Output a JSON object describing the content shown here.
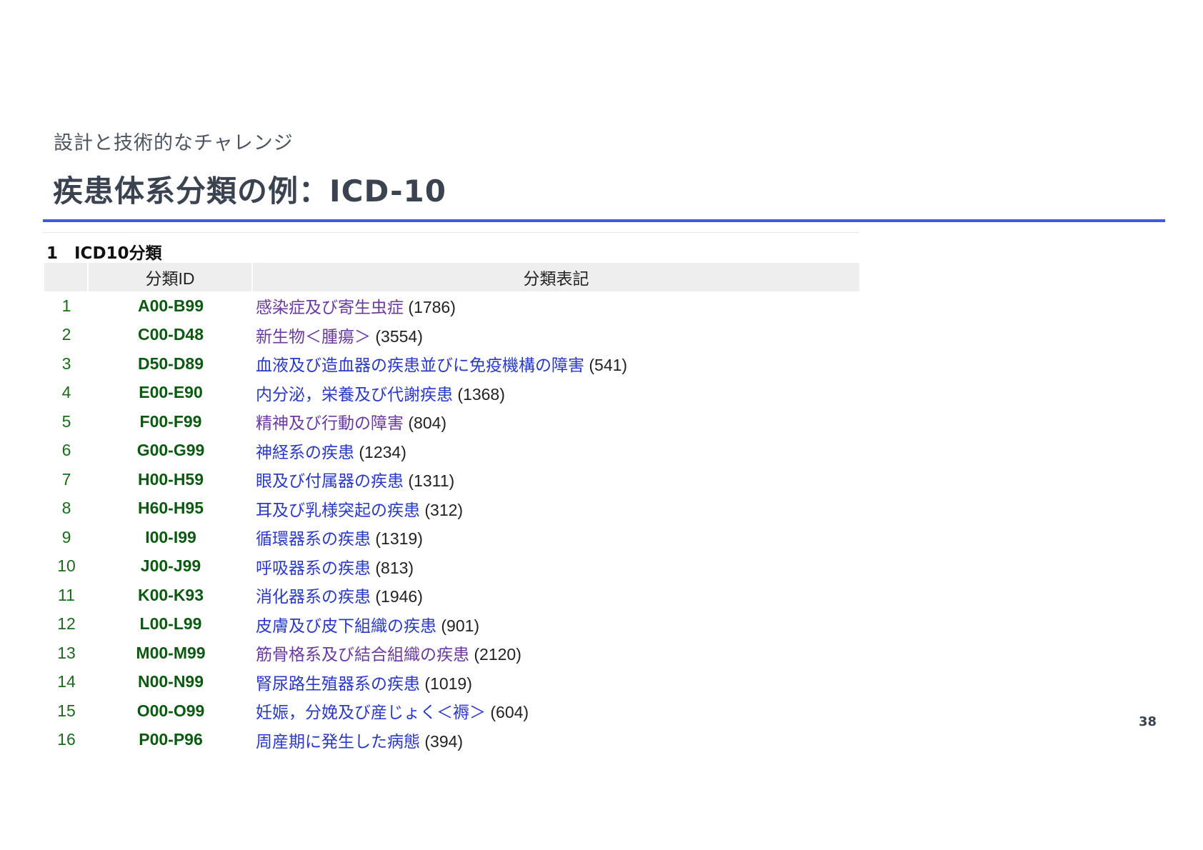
{
  "slide": {
    "subtitle": "設計と技術的なチャレンジ",
    "title": "疾患体系分類の例：ICD-10",
    "page_number": "38"
  },
  "section": {
    "heading": "1　ICD10分類"
  },
  "table": {
    "headers": [
      "",
      "分類ID",
      "分類表記"
    ],
    "rows": [
      {
        "no": "1",
        "id": "A00-B99",
        "name": "感染症及び寄生虫症",
        "count": "(1786)",
        "visited": true
      },
      {
        "no": "2",
        "id": "C00-D48",
        "name": "新生物＜腫瘍＞",
        "count": "(3554)",
        "visited": true
      },
      {
        "no": "3",
        "id": "D50-D89",
        "name": "血液及び造血器の疾患並びに免疫機構の障害",
        "count": "(541)",
        "visited": false
      },
      {
        "no": "4",
        "id": "E00-E90",
        "name": "内分泌，栄養及び代謝疾患",
        "count": "(1368)",
        "visited": false
      },
      {
        "no": "5",
        "id": "F00-F99",
        "name": "精神及び行動の障害",
        "count": "(804)",
        "visited": true
      },
      {
        "no": "6",
        "id": "G00-G99",
        "name": "神経系の疾患",
        "count": "(1234)",
        "visited": false
      },
      {
        "no": "7",
        "id": "H00-H59",
        "name": "眼及び付属器の疾患",
        "count": "(1311)",
        "visited": false
      },
      {
        "no": "8",
        "id": "H60-H95",
        "name": "耳及び乳様突起の疾患",
        "count": "(312)",
        "visited": false
      },
      {
        "no": "9",
        "id": "I00-I99",
        "name": "循環器系の疾患",
        "count": "(1319)",
        "visited": false
      },
      {
        "no": "10",
        "id": "J00-J99",
        "name": "呼吸器系の疾患",
        "count": "(813)",
        "visited": false
      },
      {
        "no": "11",
        "id": "K00-K93",
        "name": "消化器系の疾患",
        "count": "(1946)",
        "visited": false
      },
      {
        "no": "12",
        "id": "L00-L99",
        "name": "皮膚及び皮下組織の疾患",
        "count": "(901)",
        "visited": false
      },
      {
        "no": "13",
        "id": "M00-M99",
        "name": "筋骨格系及び結合組織の疾患",
        "count": "(2120)",
        "visited": true
      },
      {
        "no": "14",
        "id": "N00-N99",
        "name": "腎尿路生殖器系の疾患",
        "count": "(1019)",
        "visited": false
      },
      {
        "no": "15",
        "id": "O00-O99",
        "name": "妊娠，分娩及び産じょく＜褥＞",
        "count": "(604)",
        "visited": false
      },
      {
        "no": "16",
        "id": "P00-P96",
        "name": "周産期に発生した病態",
        "count": "(394)",
        "visited": false
      }
    ]
  },
  "colors": {
    "title_rule": "#3f5bd6",
    "id_text": "#0c5a12",
    "link_unvisited": "#2a39c8",
    "link_visited": "#6a3aa0"
  }
}
